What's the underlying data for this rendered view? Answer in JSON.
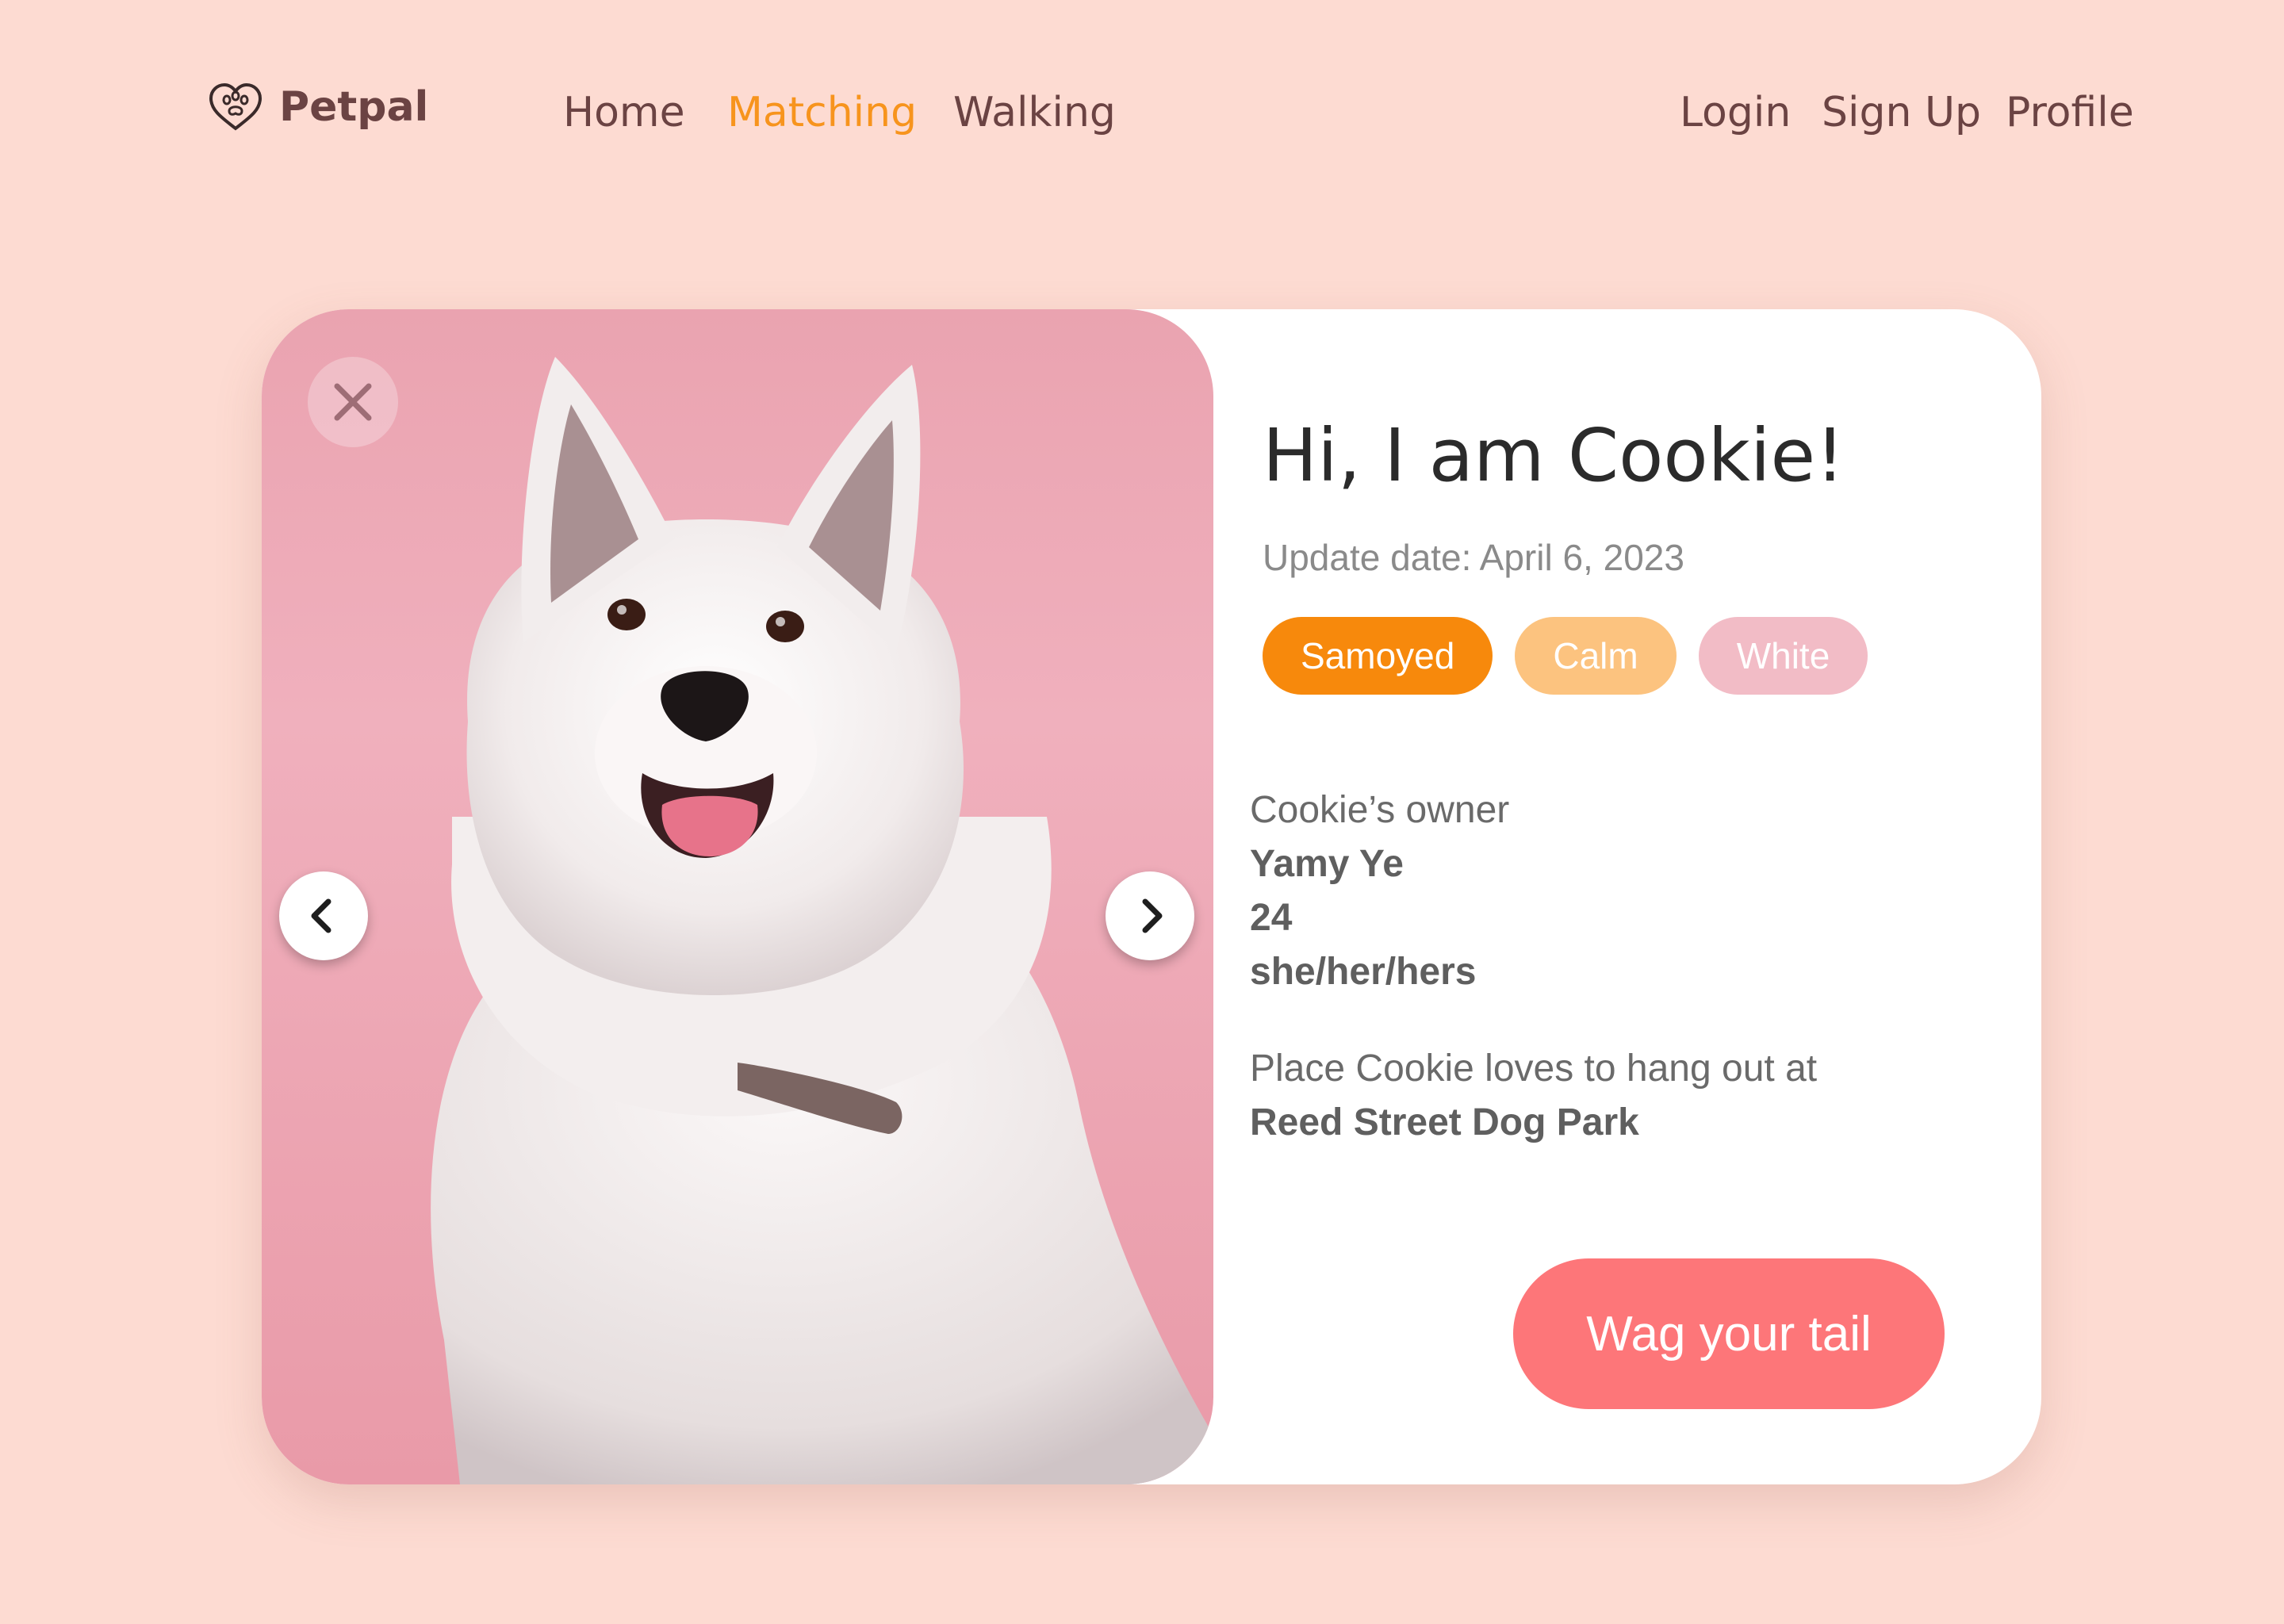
{
  "nav": {
    "brand": "Petpal",
    "links": [
      "Home",
      "Matching",
      "Walking"
    ],
    "active_link": "Matching",
    "auth": [
      "Login",
      "Sign Up",
      "Profile"
    ]
  },
  "profile": {
    "greeting": "Hi, I am Cookie!",
    "update_date": "Update date: April 6, 2023",
    "tags": [
      {
        "label": "Samoyed",
        "color": "#f7890c"
      },
      {
        "label": "Calm",
        "color": "#fcc37f"
      },
      {
        "label": "White",
        "color": "#f2bcc6"
      }
    ],
    "owner_label": "Cookie’s owner",
    "owner_name": "Yamy Ye",
    "owner_age": "24",
    "owner_pronouns": "she/her/hers",
    "place_label": "Place Cookie loves to hang out at",
    "place_name": "Reed Street Dog Park",
    "cta_label": "Wag your tail"
  },
  "colors": {
    "background": "#fddbd2",
    "nav_text": "#6b4343",
    "nav_active": "#f7941d",
    "cta": "#fd7679"
  },
  "icons": {
    "brand": "paw-heart-icon",
    "close": "close-icon",
    "prev": "chevron-left-icon",
    "next": "chevron-right-icon"
  }
}
